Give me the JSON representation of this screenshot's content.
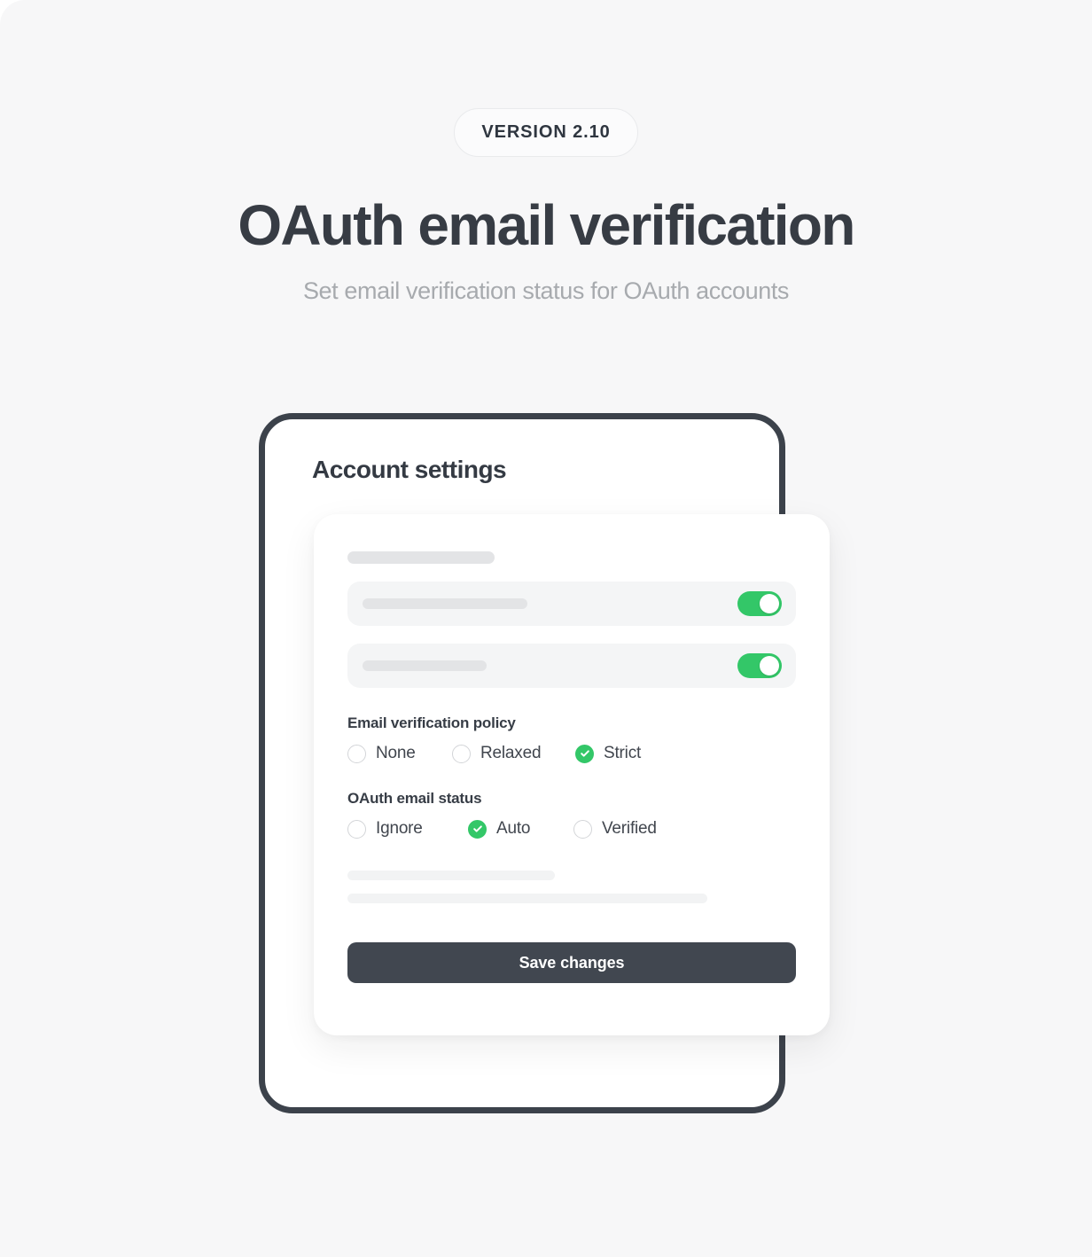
{
  "hero": {
    "version_badge": "VERSION 2.10",
    "title": "OAuth email verification",
    "subtitle": "Set email verification status for OAuth accounts"
  },
  "panel": {
    "title": "Account settings",
    "toggles": [
      {
        "name": "setting-toggle-1",
        "state": "on"
      },
      {
        "name": "setting-toggle-2",
        "state": "on"
      }
    ],
    "fields": [
      {
        "label": "Email verification policy",
        "options": [
          {
            "label": "None",
            "selected": false
          },
          {
            "label": "Relaxed",
            "selected": false
          },
          {
            "label": "Strict",
            "selected": true
          }
        ]
      },
      {
        "label": "OAuth email status",
        "options": [
          {
            "label": "Ignore",
            "selected": false
          },
          {
            "label": "Auto",
            "selected": true
          },
          {
            "label": "Verified",
            "selected": false
          }
        ]
      }
    ],
    "save_label": "Save changes"
  },
  "colors": {
    "accent_green": "#33c768",
    "dark": "#3c424b",
    "button": "#414750",
    "background": "#f7f7f8",
    "skeleton": "#e3e4e6",
    "skeleton_light": "#f2f3f4"
  }
}
